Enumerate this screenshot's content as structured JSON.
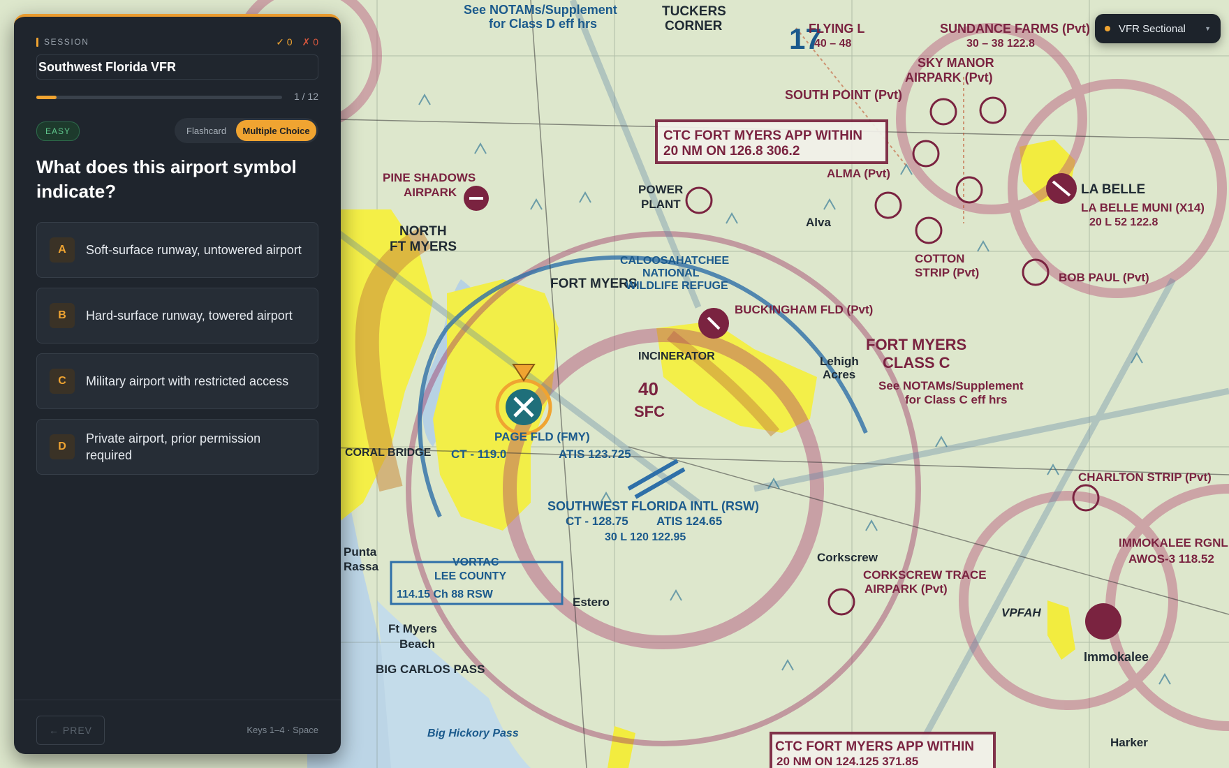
{
  "chart_selector": {
    "label": "VFR Sectional",
    "accent": "#f0a431"
  },
  "session": {
    "label": "SESSION",
    "title": "Southwest Florida VFR",
    "correct": "✓ 0",
    "wrong": "✗ 0",
    "progress": {
      "current": 1,
      "total": 12,
      "text": "1 / 12"
    }
  },
  "difficulty": "EASY",
  "modes": {
    "flashcard": "Flashcard",
    "multiple_choice": "Multiple Choice",
    "active": "multiple_choice"
  },
  "question": "What does this airport symbol indicate?",
  "answers": [
    {
      "letter": "A",
      "text": "Soft-surface runway, untowered airport"
    },
    {
      "letter": "B",
      "text": "Hard-surface runway, towered airport"
    },
    {
      "letter": "C",
      "text": "Military airport with restricted access"
    },
    {
      "letter": "D",
      "text": "Private airport, prior permission required"
    }
  ],
  "footer": {
    "prev": "← PREV",
    "hint": "Keys 1–4 · Space"
  },
  "map": {
    "labels": {
      "tuckers": "TUCKERS",
      "corner": "CORNER",
      "see_notams": "See NOTAMs/Supplement",
      "class_d": "for Class D eff hrs",
      "flying_l": "FLYING L",
      "flying_l_elev": "40 – 48",
      "sundance": "SUNDANCE FARMS (Pvt)",
      "sundance_elev": "30 – 38 122.8",
      "sky_manor": "SKY MANOR",
      "sky_manor2": "AIRPARK (Pvt)",
      "south_point": "SOUTH POINT (Pvt)",
      "ctc1": "CTC FORT MYERS APP WITHIN",
      "ctc1b": "20 NM ON 126.8  306.2",
      "pine_shadows": "PINE SHADOWS",
      "airpark": "AIRPARK",
      "north_ft_myers": "NORTH",
      "north_ft_myers2": "FT MYERS",
      "power_plant": "POWER",
      "power_plant2": "PLANT",
      "alma": "ALMA (Pvt)",
      "alva": "Alva",
      "la_belle": "LA BELLE",
      "la_belle_muni": "LA BELLE MUNI (X14)",
      "la_belle_info": "20  L 52  122.8",
      "fort_myers": "FORT MYERS",
      "caloosahatchee": "CALOOSAHATCHEE",
      "national": "NATIONAL",
      "wildlife": "WILDLIFE REFUGE",
      "cotton_strip": "COTTON",
      "cotton_strip2": "STRIP (Pvt)",
      "bob_paul": "BOB PAUL (Pvt)",
      "buckingham": "BUCKINGHAM FLD (Pvt)",
      "incinerator": "INCINERATOR",
      "fort_myers_c": "FORT MYERS",
      "class_c": "CLASS C",
      "see_notams2": "See NOTAMs/Supplement",
      "class_c_hrs": "for Class C eff hrs",
      "lehigh": "Lehigh",
      "acres": "Acres",
      "page_fld": "PAGE FLD (FMY)",
      "ct_119": "CT - 119.0",
      "atis_123": "ATIS 123.725",
      "sfc": "SFC",
      "forty": "40",
      "rsw": "SOUTHWEST FLORIDA INTL (RSW)",
      "ct_128": "CT - 128.75",
      "atis_124": "ATIS 124.65",
      "rsw_info": "30  L 120  122.95",
      "coral_bridge": "CORAL BRIDGE",
      "charlton": "CHARLTON STRIP (Pvt)",
      "immokalee_rgnl": "IMMOKALEE RGNL",
      "awos": "AWOS-3 118.52",
      "corkscrew": "Corkscrew",
      "corkscrew_trace": "CORKSCREW TRACE",
      "corkscrew_airpark": "AIRPARK (Pvt)",
      "vortac": "VORTAC",
      "lee_county": "LEE COUNTY",
      "rsw_freq": "114.15 Ch 88  RSW",
      "estero": "Estero",
      "punta": "Punta",
      "rassa": "Rassa",
      "ft_myers_beach": "Ft Myers",
      "beach": "Beach",
      "big_carlos": "BIG CARLOS PASS",
      "big_hickory": "Big Hickory Pass",
      "immokalee": "Immokalee",
      "vpfah": "VPFAH",
      "harker": "Harker",
      "ctc2": "CTC FORT MYERS APP WITHIN",
      "ctc2b": "20 NM ON 124.125  371.85",
      "seventeen": "17"
    }
  }
}
